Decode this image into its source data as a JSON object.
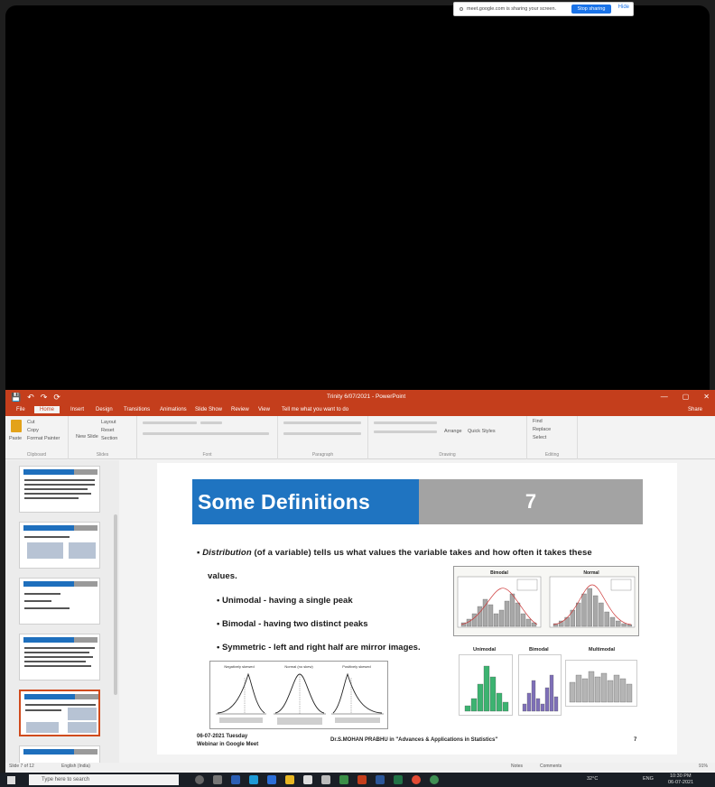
{
  "window": {
    "title": "Trinity 6/07/2021 - PowerPoint",
    "controls": [
      "—",
      "▢",
      "✕"
    ],
    "share_label": "Share"
  },
  "quick_access": [
    "💾",
    "↶",
    "↷",
    "⟳"
  ],
  "notice": {
    "text": "meet.google.com is sharing your screen.",
    "hide_label": "Stop sharing",
    "close_label": "Hide"
  },
  "tabs": [
    "File",
    "Home",
    "Insert",
    "Design",
    "Transitions",
    "Animations",
    "Slide Show",
    "Review",
    "View",
    "Tell me what you want to do"
  ],
  "ribbon": {
    "clipboard": {
      "paste": "Paste",
      "cut": "Cut",
      "copy": "Copy",
      "format_painter": "Format Painter",
      "label": "Clipboard"
    },
    "slides": {
      "new_slide": "New Slide",
      "layout": "Layout",
      "reset": "Reset",
      "section": "Section",
      "label": "Slides"
    },
    "font": {
      "label": "Font"
    },
    "paragraph": {
      "label": "Paragraph"
    },
    "drawing": {
      "arrange": "Arrange",
      "quick_styles": "Quick Styles",
      "label": "Drawing"
    },
    "editing": {
      "find": "Find",
      "replace": "Replace",
      "select": "Select",
      "label": "Editing"
    }
  },
  "thumbnails": [
    {
      "num": "3"
    },
    {
      "num": "4"
    },
    {
      "num": "5"
    },
    {
      "num": "6"
    },
    {
      "num": "7",
      "selected": true
    },
    {
      "num": "8"
    }
  ],
  "slide": {
    "title": "Some Definitions",
    "number": "7",
    "intro_term": "Distribution",
    "intro_rest": "(of a variable) tells us what values the variable takes and how often it takes these",
    "intro_cont": "values.",
    "bullets": [
      "Unimodal - having a single peak",
      "Bimodal - having two distinct peaks",
      "Symmetric - left and right half are mirror images."
    ],
    "footer_left_1": "06-07-2021 Tuesday",
    "footer_left_2": "Webinar in Google Meet",
    "footer_center": "Dr.S.MOHAN PRABHU in \"Advances & Applications in Statistics\"",
    "footer_page": "7",
    "curve_labels": [
      "Negatively skewed",
      "Normal (no skew)",
      "Positively skewed"
    ],
    "hist_titles": [
      "Bimodal",
      "Normal"
    ],
    "small_titles": [
      "Unimodal",
      "Bimodal",
      "Multimodal"
    ]
  },
  "statusbar": {
    "slide_info": "Slide 7 of 12",
    "language": "English (India)",
    "notes": "Notes",
    "comments": "Comments",
    "zoom": "91%"
  },
  "taskbar": {
    "search_placeholder": "Type here to search",
    "temp": "32°C",
    "lang": "ENG",
    "time": "10:30 PM",
    "date": "06-07-2021"
  },
  "colors": {
    "ppt_red": "#c43e1c",
    "slide_blue": "#1f74c1",
    "slide_gray": "#a3a3a3",
    "hist_gray": "#a8a8a8",
    "hist_green": "#3cb371",
    "hist_purple": "#7e6fb8"
  }
}
